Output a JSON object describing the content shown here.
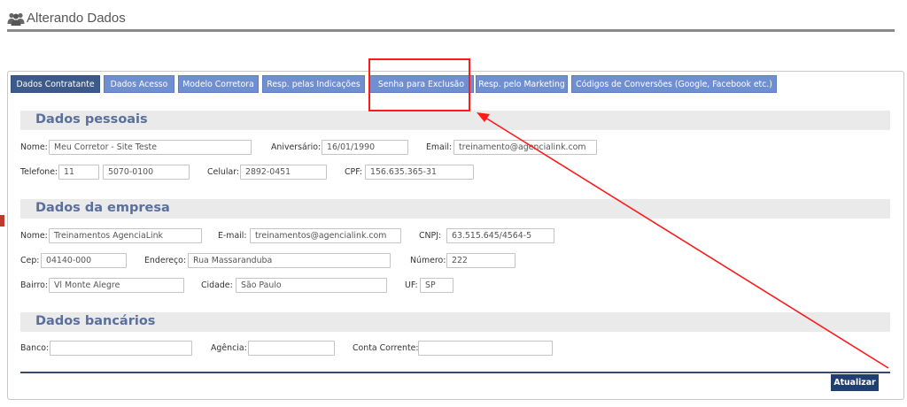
{
  "header": {
    "title": "Alterando Dados",
    "icon": "users-icon"
  },
  "tabs": [
    {
      "label": "Dados Contratante",
      "active": true
    },
    {
      "label": "Dados Acesso"
    },
    {
      "label": "Modelo Corretora"
    },
    {
      "label": "Resp. pelas Indicações"
    },
    {
      "label": "Senha para Exclusão"
    },
    {
      "label": "Resp. pelo Marketing"
    },
    {
      "label": "Códigos de Conversões (Google, Facebook etc.)"
    }
  ],
  "sections": {
    "pessoais": {
      "title": "Dados pessoais",
      "fields": {
        "nome": {
          "label": "Nome:",
          "value": "Meu Corretor - Site Teste"
        },
        "aniversario": {
          "label": "Aniversário:",
          "value": "16/01/1990"
        },
        "email": {
          "label": "Email:",
          "value": "treinamento@agencialink.com"
        },
        "telefone": {
          "label": "Telefone:",
          "ddd": "11",
          "value": "5070-0100"
        },
        "celular": {
          "label": "Celular:",
          "value": "2892-0451"
        },
        "cpf": {
          "label": "CPF:",
          "value": "156.635.365-31"
        }
      }
    },
    "empresa": {
      "title": "Dados da empresa",
      "fields": {
        "nome": {
          "label": "Nome:",
          "value": "Treinamentos AgenciaLink"
        },
        "email": {
          "label": "E-mail:",
          "value": "treinamentos@agencialink.com"
        },
        "cnpj": {
          "label": "CNPJ:",
          "value": "63.515.645/4564-5"
        },
        "cep": {
          "label": "Cep:",
          "value": "04140-000"
        },
        "endereco": {
          "label": "Endereço:",
          "value": "Rua Massaranduba"
        },
        "numero": {
          "label": "Número:",
          "value": "222"
        },
        "bairro": {
          "label": "Bairro:",
          "value": "Vl Monte Alegre"
        },
        "cidade": {
          "label": "Cidade:",
          "value": "São Paulo"
        },
        "uf": {
          "label": "UF:",
          "value": "SP"
        }
      }
    },
    "bancarios": {
      "title": "Dados bancários",
      "fields": {
        "banco": {
          "label": "Banco:",
          "value": ""
        },
        "agencia": {
          "label": "Agência:",
          "value": ""
        },
        "conta": {
          "label": "Conta Corrente:",
          "value": ""
        }
      }
    }
  },
  "actions": {
    "atualizar": "Atualizar"
  },
  "colors": {
    "tab": "#6f8fd0",
    "tab_active": "#3d5a8a",
    "section_title": "#5a6f9c",
    "button": "#1f3f70",
    "annotation": "#ff1a1a"
  }
}
